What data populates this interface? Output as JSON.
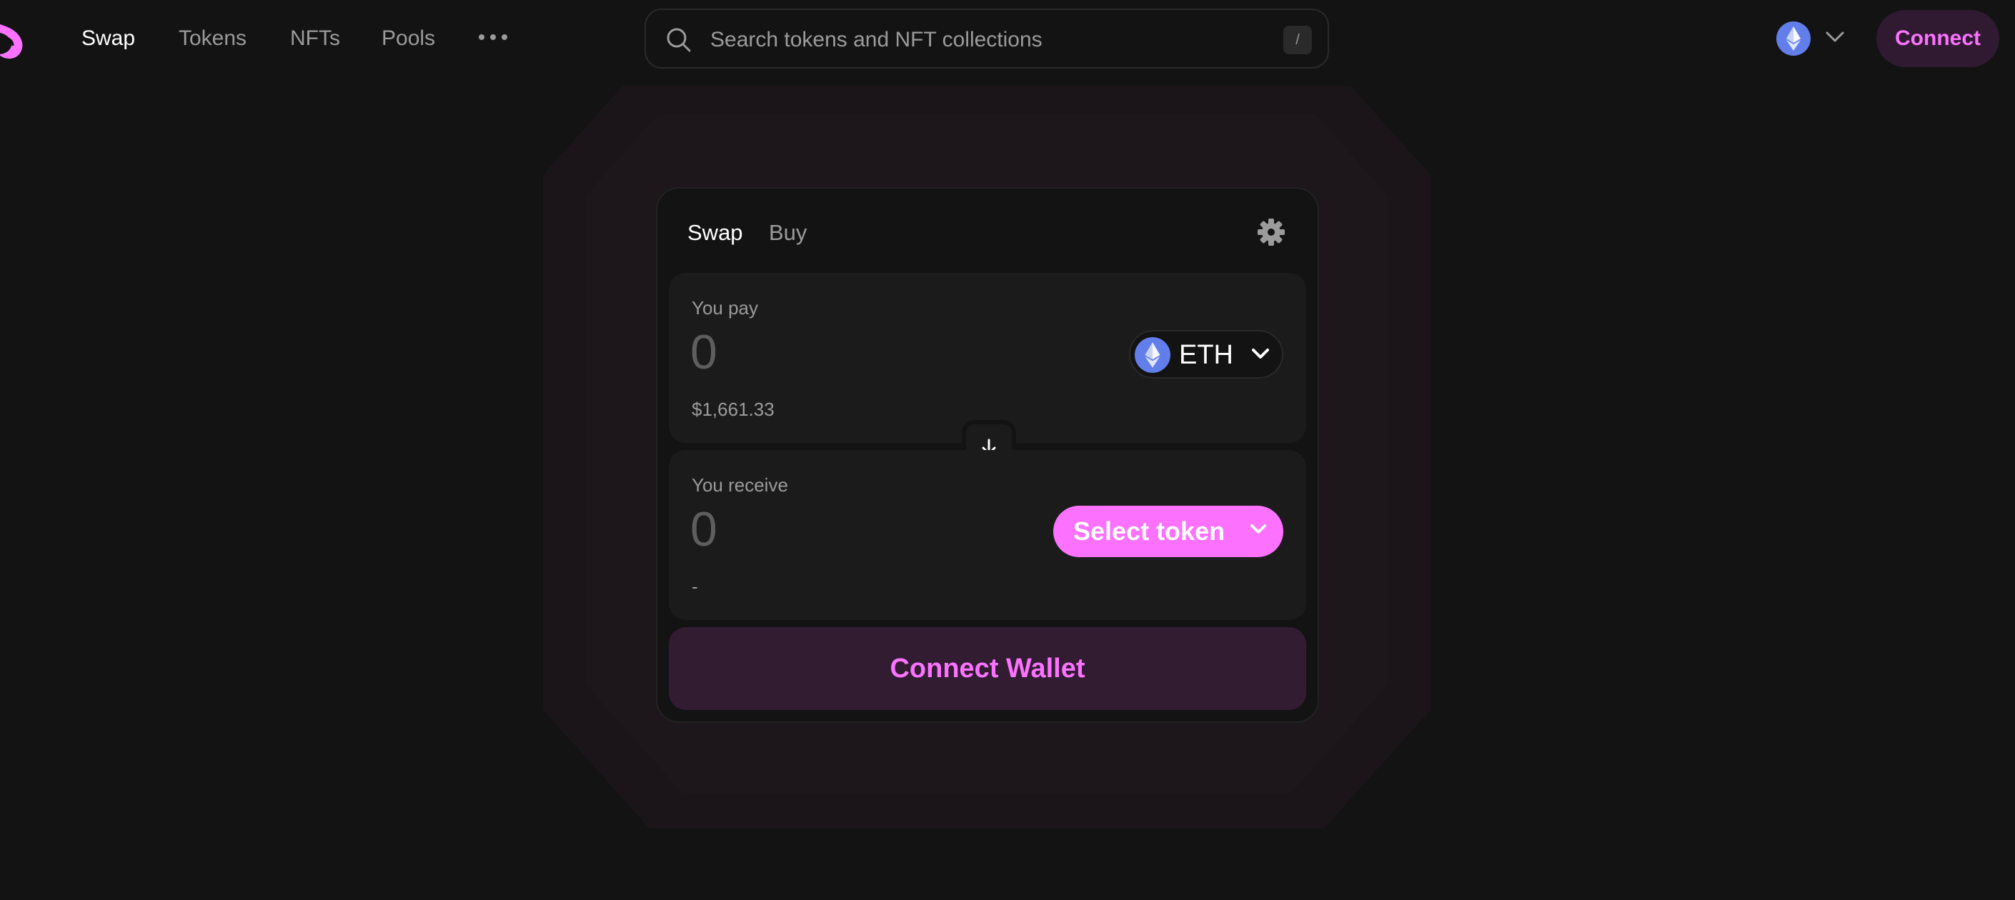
{
  "nav": {
    "links": [
      {
        "label": "Swap",
        "active": true
      },
      {
        "label": "Tokens",
        "active": false
      },
      {
        "label": "NFTs",
        "active": false
      },
      {
        "label": "Pools",
        "active": false
      }
    ],
    "more_icon": "more-dots-icon",
    "logo_icon": "unicorn-logo-icon"
  },
  "search": {
    "placeholder": "Search tokens and NFT collections",
    "value": "",
    "shortcut": "/",
    "icon": "search-icon"
  },
  "network": {
    "icon": "ethereum-icon"
  },
  "header": {
    "connect_label": "Connect"
  },
  "swap": {
    "tabs": [
      {
        "label": "Swap",
        "active": true
      },
      {
        "label": "Buy",
        "active": false
      }
    ],
    "settings_icon": "gear-icon",
    "pay": {
      "label": "You pay",
      "amount_placeholder": "0",
      "amount": "",
      "fiat": "$1,661.33",
      "token": "ETH"
    },
    "switch_icon": "arrow-down-icon",
    "receive": {
      "label": "You receive",
      "amount_placeholder": "0",
      "amount": "",
      "fiat": "-",
      "select_label": "Select token"
    },
    "connect_wallet_label": "Connect Wallet"
  },
  "colors": {
    "background": "#131313",
    "accent": "#fc72ff",
    "accent_soft_bg": "#311c31",
    "eth_blue": "#627eea",
    "text_secondary": "#9b9b9b"
  }
}
